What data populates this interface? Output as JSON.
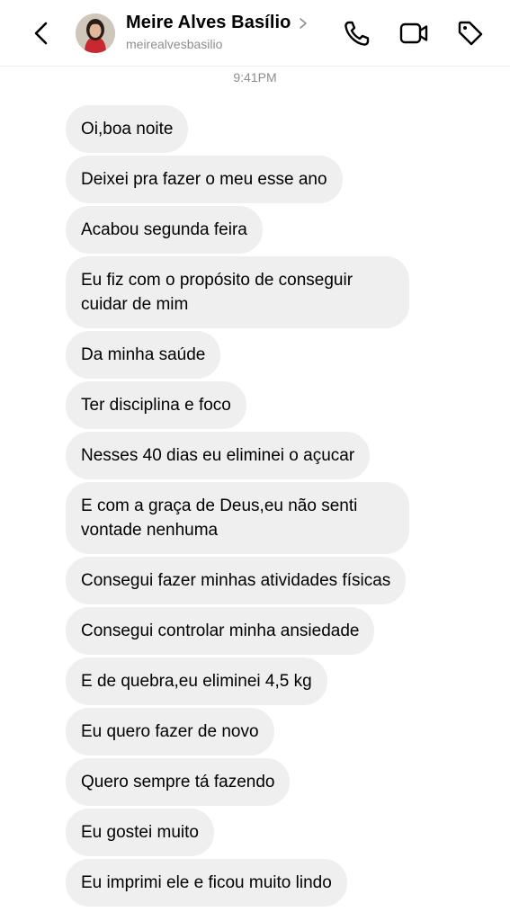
{
  "header": {
    "contact_name": "Meire Alves Basílio",
    "username": "meirealvesbasilio",
    "icons": [
      "back-arrow-icon",
      "chevron-right-icon",
      "phone-icon",
      "video-camera-icon",
      "tag-icon"
    ]
  },
  "thread": {
    "timestamp": "9:41PM",
    "messages": [
      "Oi,boa noite",
      "Deixei pra fazer o meu esse ano",
      "Acabou segunda feira",
      "Eu fiz com o propósito de conseguir cuidar de mim",
      "Da minha saúde",
      "Ter disciplina e foco",
      "Nesses 40 dias eu eliminei o açucar",
      "E com a graça de Deus,eu não senti vontade nenhuma",
      "Consegui fazer minhas atividades físicas",
      "Consegui controlar minha ansiedade",
      "E de quebra,eu eliminei 4,5 kg",
      "Eu quero fazer de novo",
      "Quero sempre tá fazendo",
      "Eu gostei muito",
      "Eu imprimi ele e ficou muito lindo"
    ]
  },
  "colors": {
    "bubble_bg": "#efefef",
    "muted_text": "#8e8e8e",
    "header_border": "#ececec"
  }
}
